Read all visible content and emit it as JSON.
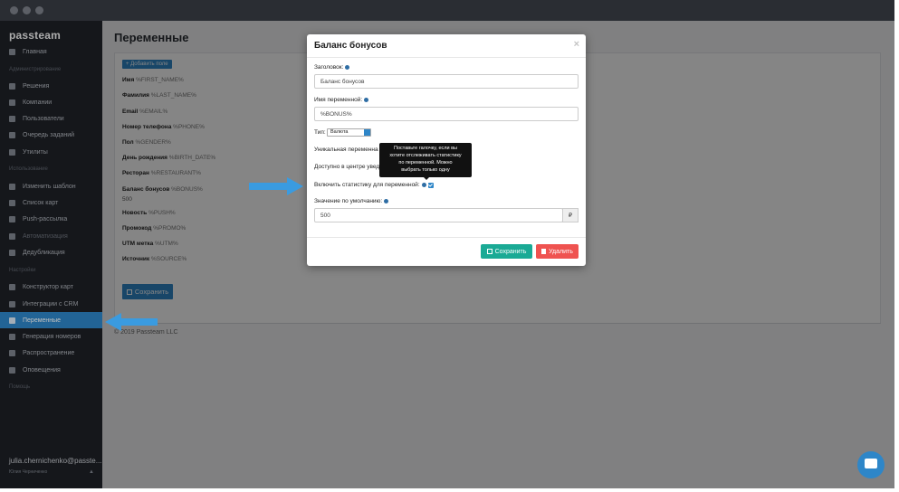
{
  "sidebar": {
    "logo": "passteam",
    "sections": [
      {
        "heading": "",
        "items": [
          {
            "label": "Главная"
          }
        ]
      },
      {
        "heading": "Администрирование",
        "items": [
          {
            "label": "Решения"
          },
          {
            "label": "Компании"
          },
          {
            "label": "Пользователи"
          },
          {
            "label": "Очередь заданий"
          },
          {
            "label": "Утилиты"
          }
        ]
      },
      {
        "heading": "Использование",
        "items": [
          {
            "label": "Изменить шаблон"
          },
          {
            "label": "Список карт"
          },
          {
            "label": "Push-рассылка"
          },
          {
            "label": "Автоматизация"
          },
          {
            "label": "Дедубликация"
          }
        ]
      },
      {
        "heading": "Настройки",
        "items": [
          {
            "label": "Конструктор карт"
          },
          {
            "label": "Интеграции с CRM"
          },
          {
            "label": "Переменные"
          },
          {
            "label": "Генерация номеров"
          },
          {
            "label": "Распространение"
          },
          {
            "label": "Оповещения"
          }
        ]
      },
      {
        "heading": "Помощь",
        "items": []
      }
    ],
    "active_item": "Переменные",
    "user_email": "julia.chernichenko@passte...",
    "user_name": "Юлия Черниченко"
  },
  "main": {
    "title": "Переменные",
    "add_button": "+ Добавить поле",
    "variables": [
      {
        "name": "Имя",
        "token": "%FIRST_NAME%"
      },
      {
        "name": "Фамилия",
        "token": "%LAST_NAME%"
      },
      {
        "name": "Email",
        "token": "%EMAIL%"
      },
      {
        "name": "Номер телефона",
        "token": "%PHONE%"
      },
      {
        "name": "Пол",
        "token": "%GENDER%"
      },
      {
        "name": "День рождения",
        "token": "%BIRTH_DATE%"
      },
      {
        "name": "Ресторан",
        "token": "%RESTAURANT%"
      },
      {
        "name": "Баланс бонусов",
        "token": "%BONUS%"
      },
      {
        "name": "Новость",
        "token": "%PUSH%"
      },
      {
        "name": "Промокод",
        "token": "%PROMO%"
      },
      {
        "name": "UTM метка",
        "token": "%UTM%"
      },
      {
        "name": "Источник",
        "token": "%SOURCE%"
      }
    ],
    "bonus_value": "500",
    "save_button": "Сохранить",
    "footer": "© 2019 Passteam LLC"
  },
  "modal": {
    "title": "Баланс бонусов",
    "close": "×",
    "header_label": "Заголовок:",
    "header_value": "Баланс бонусов",
    "varname_label": "Имя переменной:",
    "varname_value": "%BONUS%",
    "type_label": "Тип:",
    "type_value": "Валюта",
    "unique_label": "Уникальная переменна",
    "notify_label": "Доступно в центре увед",
    "stats_label": "Включить статистику для переменной:",
    "default_label": "Значение по умолчанию:",
    "default_value": "500",
    "currency": "₽",
    "save_button": "Сохранить",
    "delete_button": "Удалить",
    "tooltip_lines": [
      "Поставьте галочку, если вы",
      "хотите отслеживать статистику",
      "по переменной. Можно",
      "выбрать только одну"
    ]
  },
  "colors": {
    "accent": "#2e86c8",
    "save_green": "#1aaa95",
    "delete_red": "#ef5350",
    "sidebar_bg": "#1c1f25",
    "arrow_blue": "#3a9be0"
  }
}
